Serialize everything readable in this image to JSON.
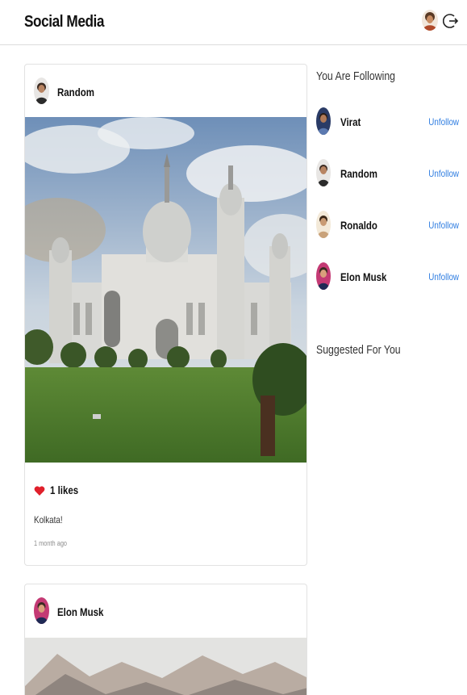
{
  "header": {
    "brand": "Social Media",
    "avatar_icon": "user-avatar",
    "logout_icon": "logout-icon"
  },
  "posts": [
    {
      "username": "Random",
      "image": "victoria-memorial-photo",
      "likes": "1 likes",
      "caption": "Kolkata!",
      "time": "1 month ago"
    },
    {
      "username": "Elon Musk",
      "image": "mountain-photo"
    }
  ],
  "sidebar": {
    "following_heading": "You Are Following",
    "following": [
      {
        "name": "Virat",
        "action": "Unfollow"
      },
      {
        "name": "Random",
        "action": "Unfollow"
      },
      {
        "name": "Ronaldo",
        "action": "Unfollow"
      },
      {
        "name": "Elon Musk",
        "action": "Unfollow"
      }
    ],
    "suggested_heading": "Suggested For You"
  },
  "colors": {
    "accent": "#2f7de1",
    "like": "#e0202b",
    "border": "#e2e2e2"
  }
}
